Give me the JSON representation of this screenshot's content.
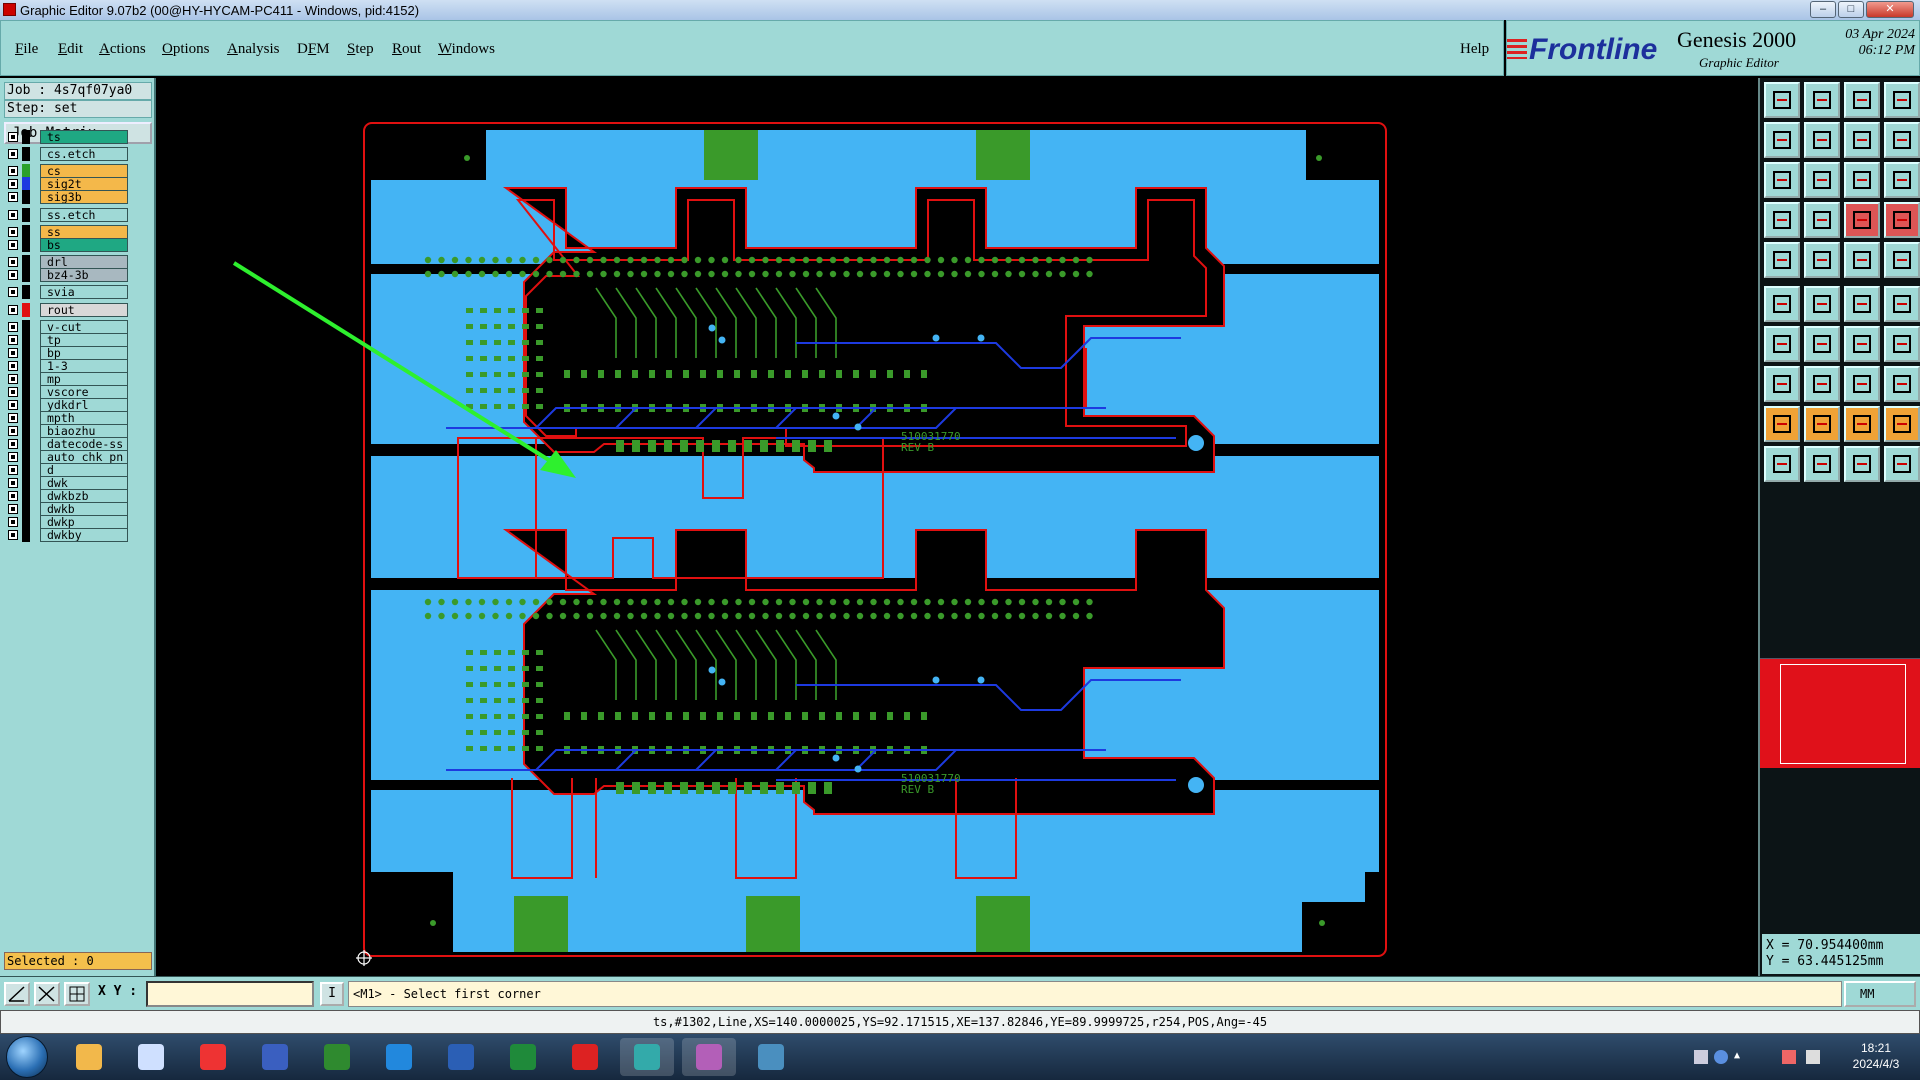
{
  "window": {
    "title": "Graphic Editor 9.07b2 (00@HY-HYCAM-PC411 - Windows, pid:4152)",
    "controls": [
      "–",
      "□",
      "✕"
    ]
  },
  "menubar": {
    "items": [
      {
        "label": "File",
        "mnemonic_index": 0
      },
      {
        "label": "Edit",
        "mnemonic_index": 0
      },
      {
        "label": "Actions",
        "mnemonic_index": 0
      },
      {
        "label": "Options",
        "mnemonic_index": 0
      },
      {
        "label": "Analysis",
        "mnemonic_index": 0
      },
      {
        "label": "DFM",
        "mnemonic_index": 1
      },
      {
        "label": "Step",
        "mnemonic_index": 0
      },
      {
        "label": "Rout",
        "mnemonic_index": 0
      },
      {
        "label": "Windows",
        "mnemonic_index": 0
      }
    ],
    "help": "Help"
  },
  "brand": {
    "logo": "Frontline",
    "product": "Genesis 2000",
    "subtitle": "Graphic Editor",
    "date": "03 Apr 2024",
    "time": "06:12 PM"
  },
  "job_panel": {
    "job": "Job : 4s7qf07ya0",
    "step": "Step: set",
    "job_matrix": "Job Matrix ...",
    "selected": "Selected : 0"
  },
  "layers": [
    {
      "name": "ts",
      "bg": "#1fa883",
      "swatch": "#000000"
    },
    {
      "name": "cs.etch",
      "bg": "#9fd9d6",
      "swatch": "#000000"
    },
    {
      "name": "cs",
      "bg": "#f4b84a",
      "swatch": "#2aa12a"
    },
    {
      "name": "sig2t",
      "bg": "#f4b84a",
      "swatch": "#1d3ae0"
    },
    {
      "name": "sig3b",
      "bg": "#f4b84a",
      "swatch": "#000000"
    },
    {
      "name": "ss.etch",
      "bg": "#9fd9d6",
      "swatch": "#000000"
    },
    {
      "name": "ss",
      "bg": "#f4b84a",
      "swatch": "#000000"
    },
    {
      "name": "bs",
      "bg": "#1fa883",
      "swatch": "#000000"
    },
    {
      "name": "drl",
      "bg": "#a8b8c0",
      "swatch": "#000000"
    },
    {
      "name": "bz4-3b",
      "bg": "#a8b8c0",
      "swatch": "#000000"
    },
    {
      "name": "svia",
      "bg": "#9fd9d6",
      "swatch": "#000000"
    },
    {
      "name": "rout",
      "bg": "#d8d8d8",
      "swatch": "#e01010"
    },
    {
      "name": "v-cut",
      "bg": "#9fd9d6",
      "swatch": "#000000"
    },
    {
      "name": "tp",
      "bg": "#9fd9d6",
      "swatch": "#000000"
    },
    {
      "name": "bp",
      "bg": "#9fd9d6",
      "swatch": "#000000"
    },
    {
      "name": "1-3",
      "bg": "#9fd9d6",
      "swatch": "#000000"
    },
    {
      "name": "mp",
      "bg": "#9fd9d6",
      "swatch": "#000000"
    },
    {
      "name": "vscore",
      "bg": "#9fd9d6",
      "swatch": "#000000"
    },
    {
      "name": "ydkdrl",
      "bg": "#9fd9d6",
      "swatch": "#000000"
    },
    {
      "name": "mpth",
      "bg": "#9fd9d6",
      "swatch": "#000000"
    },
    {
      "name": "biaozhu",
      "bg": "#9fd9d6",
      "swatch": "#000000"
    },
    {
      "name": "datecode-ss",
      "bg": "#9fd9d6",
      "swatch": "#000000"
    },
    {
      "name": "auto_chk_pn",
      "bg": "#9fd9d6",
      "swatch": "#000000"
    },
    {
      "name": "d",
      "bg": "#9fd9d6",
      "swatch": "#000000"
    },
    {
      "name": "dwk",
      "bg": "#9fd9d6",
      "swatch": "#000000"
    },
    {
      "name": "dwkbzb",
      "bg": "#9fd9d6",
      "swatch": "#000000"
    },
    {
      "name": "dwkb",
      "bg": "#9fd9d6",
      "swatch": "#000000"
    },
    {
      "name": "dwkp",
      "bg": "#9fd9d6",
      "swatch": "#000000"
    },
    {
      "name": "dwkby",
      "bg": "#9fd9d6",
      "swatch": "#000000"
    }
  ],
  "canvas": {
    "board_labels": [
      "510031770",
      "REV B"
    ]
  },
  "coords": {
    "x": "X = 70.954400mm",
    "y": "Y = 63.445125mm"
  },
  "command": {
    "xy_label": "X Y :",
    "xy_value": "",
    "prompt": "<M1> - Select first corner",
    "units": "MM"
  },
  "status": {
    "text": "ts,#1302,Line,XS=140.0000025,YS=92.171515,XE=137.82846,YE=89.9999725,r254,POS,Ang=-45"
  },
  "taskbar": {
    "time": "18:21",
    "date": "2024/4/3"
  },
  "colors": {
    "ui_teal": "#9fd9d6",
    "board_blue": "#44b4f4",
    "copper_green": "#3a9a2a",
    "rout_red": "#e01010",
    "trace_blue": "#1d3ae0"
  }
}
